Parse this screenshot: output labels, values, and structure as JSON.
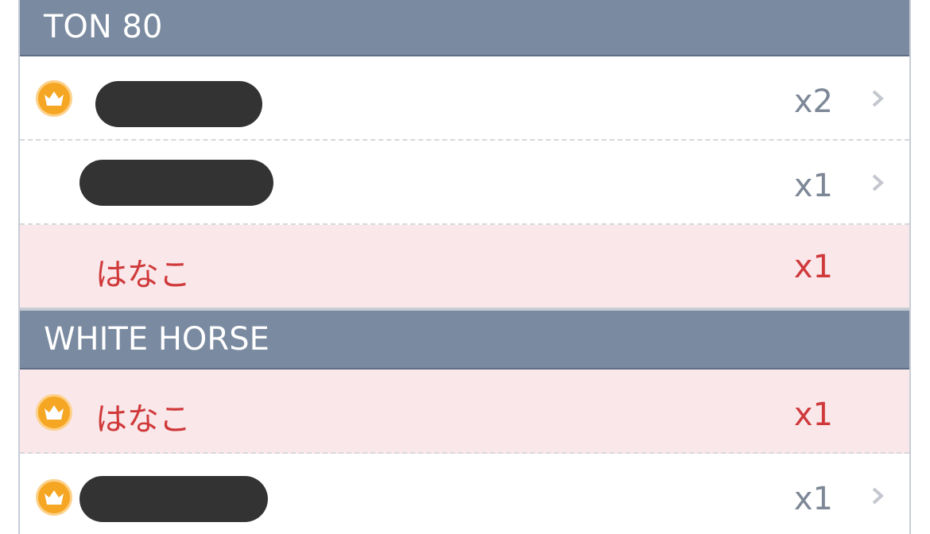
{
  "sections": [
    {
      "title": "TON 80",
      "rows": [
        {
          "name": "",
          "redacted": true,
          "crown": true,
          "count": "x2",
          "highlight": false,
          "chevron": true
        },
        {
          "name": "",
          "redacted": true,
          "crown": false,
          "count": "x1",
          "highlight": false,
          "chevron": true
        },
        {
          "name": "はなこ",
          "redacted": false,
          "crown": false,
          "count": "x1",
          "highlight": true,
          "chevron": false
        }
      ]
    },
    {
      "title": "WHITE HORSE",
      "rows": [
        {
          "name": "はなこ",
          "redacted": false,
          "crown": true,
          "count": "x1",
          "highlight": true,
          "chevron": false
        },
        {
          "name": "",
          "redacted": true,
          "crown": true,
          "count": "x1",
          "highlight": false,
          "chevron": true
        }
      ]
    }
  ],
  "colors": {
    "header_bg": "#7a8aa0",
    "highlight_bg": "#f9e7ea",
    "highlight_text": "#d0393a",
    "count_text": "#7d8796",
    "crown": "#f5a623"
  },
  "icons": {
    "crown": "crown-icon",
    "chevron": "chevron-right-icon"
  }
}
